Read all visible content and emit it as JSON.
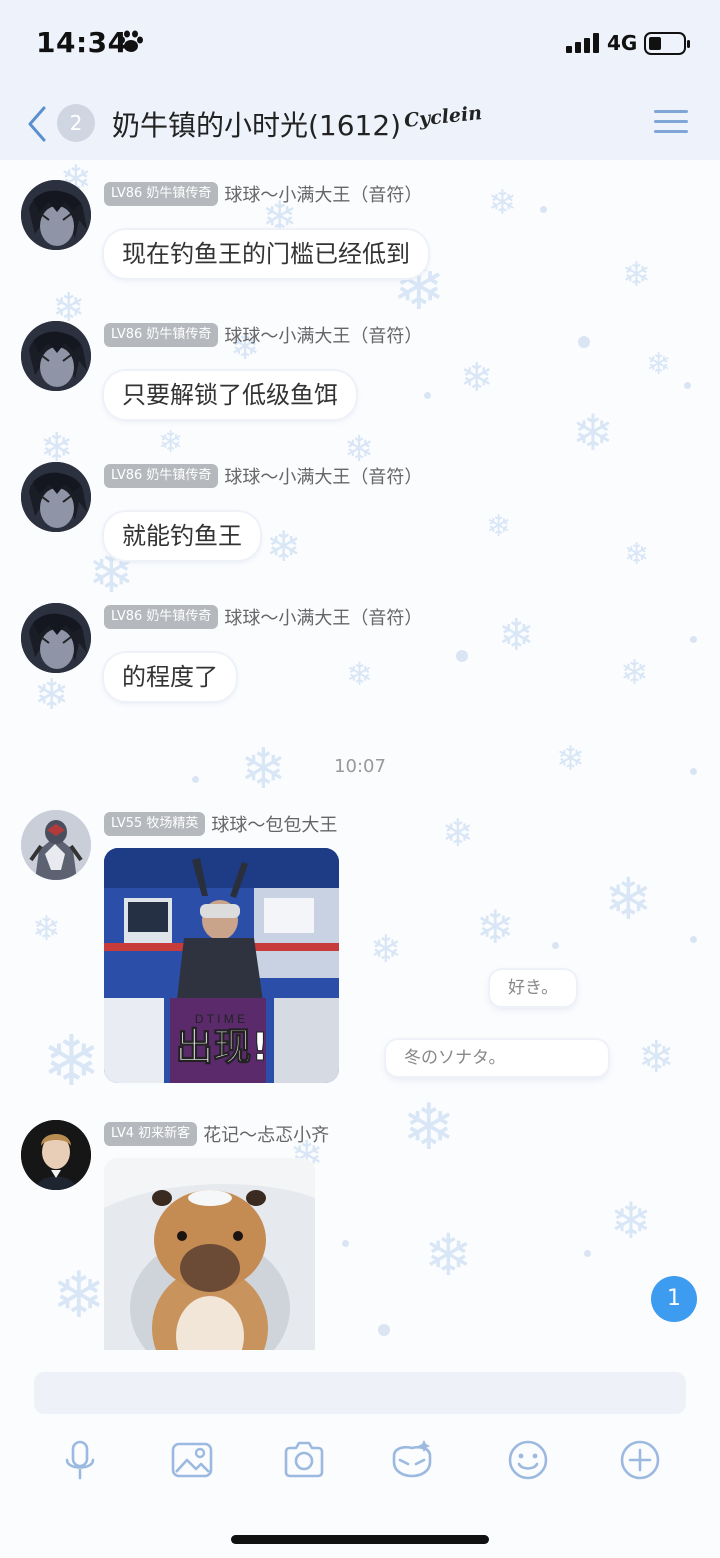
{
  "status_bar": {
    "time": "14:34",
    "network": "4G"
  },
  "nav": {
    "unread_count": "2",
    "title": "奶牛镇的小时光(1612)",
    "logo_text": "Cyclein"
  },
  "messages": [
    {
      "level": "LV86 奶牛镇传奇",
      "sender": "球球～小满大王（音符）",
      "text": "现在钓鱼王的门槛已经低到"
    },
    {
      "level": "LV86 奶牛镇传奇",
      "sender": "球球～小满大王（音符）",
      "text": "只要解锁了低级鱼饵"
    },
    {
      "level": "LV86 奶牛镇传奇",
      "sender": "球球～小满大王（音符）",
      "text": "就能钓鱼王"
    },
    {
      "level": "LV86 奶牛镇传奇",
      "sender": "球球～小满大王（音符）",
      "text": "的程度了"
    }
  ],
  "timestamp": "10:07",
  "image_messages": [
    {
      "level": "LV55 牧场精英",
      "sender": "球球～包包大王",
      "caption": "出现!",
      "box_text": "D T I M E"
    },
    {
      "level": "LV4 初来新客",
      "sender": "花记～忐忑小齐"
    }
  ],
  "barrage": [
    "好き。",
    "冬のソナタ。"
  ],
  "new_message_count": "1",
  "toolbar": {
    "icons": [
      "microphone-icon",
      "image-icon",
      "camera-icon",
      "sticker-icon",
      "emoji-icon",
      "plus-icon"
    ]
  }
}
